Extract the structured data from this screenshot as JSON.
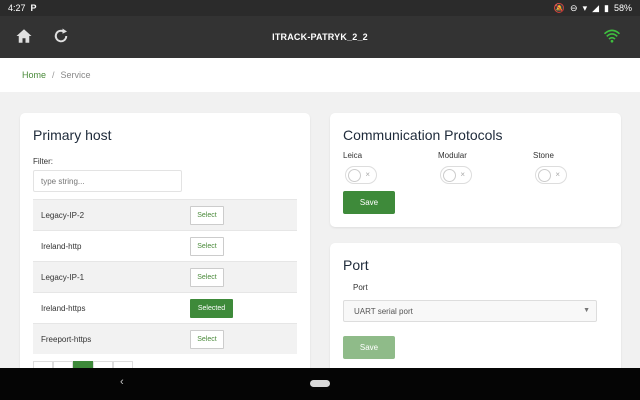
{
  "statusbar": {
    "time": "4:27",
    "app_icon": "P",
    "battery": "58%"
  },
  "appbar": {
    "title": "ITRACK-PATRYK_2_2"
  },
  "breadcrumb": {
    "home": "Home",
    "separator": "/",
    "current": "Service"
  },
  "primary_host": {
    "title": "Primary host",
    "filter_label": "Filter:",
    "filter_placeholder": "type string...",
    "hosts": [
      {
        "name": "Legacy-IP-2",
        "button": "Select"
      },
      {
        "name": "Ireland-http",
        "button": "Select"
      },
      {
        "name": "Legacy-IP-1",
        "button": "Select"
      },
      {
        "name": "Ireland-https",
        "button": "Selected"
      },
      {
        "name": "Freeport-https",
        "button": "Select"
      }
    ]
  },
  "protocols": {
    "title": "Communication Protocols",
    "items": [
      {
        "label": "Leica",
        "toggle_mark": "×"
      },
      {
        "label": "Modular",
        "toggle_mark": "×"
      },
      {
        "label": "Stone",
        "toggle_mark": "×"
      }
    ],
    "save_label": "Save"
  },
  "port": {
    "title": "Port",
    "label": "Port",
    "selected": "UART serial port",
    "save_label": "Save"
  },
  "colors": {
    "accent": "#3e8a3a",
    "appbar": "#333333",
    "wifi": "#3fbf3f"
  }
}
